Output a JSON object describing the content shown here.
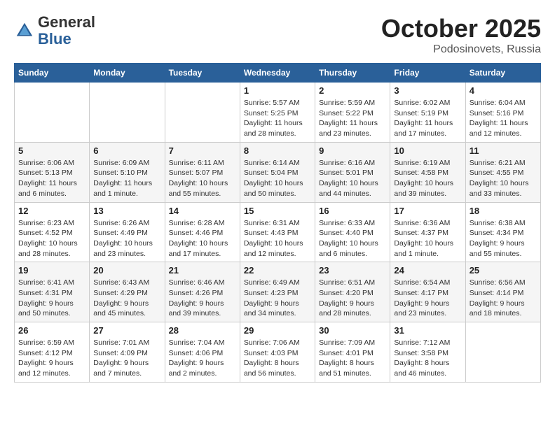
{
  "logo": {
    "general": "General",
    "blue": "Blue"
  },
  "header": {
    "month": "October 2025",
    "location": "Podosinovets, Russia"
  },
  "weekdays": [
    "Sunday",
    "Monday",
    "Tuesday",
    "Wednesday",
    "Thursday",
    "Friday",
    "Saturday"
  ],
  "weeks": [
    [
      {
        "day": "",
        "info": ""
      },
      {
        "day": "",
        "info": ""
      },
      {
        "day": "",
        "info": ""
      },
      {
        "day": "1",
        "info": "Sunrise: 5:57 AM\nSunset: 5:25 PM\nDaylight: 11 hours\nand 28 minutes."
      },
      {
        "day": "2",
        "info": "Sunrise: 5:59 AM\nSunset: 5:22 PM\nDaylight: 11 hours\nand 23 minutes."
      },
      {
        "day": "3",
        "info": "Sunrise: 6:02 AM\nSunset: 5:19 PM\nDaylight: 11 hours\nand 17 minutes."
      },
      {
        "day": "4",
        "info": "Sunrise: 6:04 AM\nSunset: 5:16 PM\nDaylight: 11 hours\nand 12 minutes."
      }
    ],
    [
      {
        "day": "5",
        "info": "Sunrise: 6:06 AM\nSunset: 5:13 PM\nDaylight: 11 hours\nand 6 minutes."
      },
      {
        "day": "6",
        "info": "Sunrise: 6:09 AM\nSunset: 5:10 PM\nDaylight: 11 hours\nand 1 minute."
      },
      {
        "day": "7",
        "info": "Sunrise: 6:11 AM\nSunset: 5:07 PM\nDaylight: 10 hours\nand 55 minutes."
      },
      {
        "day": "8",
        "info": "Sunrise: 6:14 AM\nSunset: 5:04 PM\nDaylight: 10 hours\nand 50 minutes."
      },
      {
        "day": "9",
        "info": "Sunrise: 6:16 AM\nSunset: 5:01 PM\nDaylight: 10 hours\nand 44 minutes."
      },
      {
        "day": "10",
        "info": "Sunrise: 6:19 AM\nSunset: 4:58 PM\nDaylight: 10 hours\nand 39 minutes."
      },
      {
        "day": "11",
        "info": "Sunrise: 6:21 AM\nSunset: 4:55 PM\nDaylight: 10 hours\nand 33 minutes."
      }
    ],
    [
      {
        "day": "12",
        "info": "Sunrise: 6:23 AM\nSunset: 4:52 PM\nDaylight: 10 hours\nand 28 minutes."
      },
      {
        "day": "13",
        "info": "Sunrise: 6:26 AM\nSunset: 4:49 PM\nDaylight: 10 hours\nand 23 minutes."
      },
      {
        "day": "14",
        "info": "Sunrise: 6:28 AM\nSunset: 4:46 PM\nDaylight: 10 hours\nand 17 minutes."
      },
      {
        "day": "15",
        "info": "Sunrise: 6:31 AM\nSunset: 4:43 PM\nDaylight: 10 hours\nand 12 minutes."
      },
      {
        "day": "16",
        "info": "Sunrise: 6:33 AM\nSunset: 4:40 PM\nDaylight: 10 hours\nand 6 minutes."
      },
      {
        "day": "17",
        "info": "Sunrise: 6:36 AM\nSunset: 4:37 PM\nDaylight: 10 hours\nand 1 minute."
      },
      {
        "day": "18",
        "info": "Sunrise: 6:38 AM\nSunset: 4:34 PM\nDaylight: 9 hours\nand 55 minutes."
      }
    ],
    [
      {
        "day": "19",
        "info": "Sunrise: 6:41 AM\nSunset: 4:31 PM\nDaylight: 9 hours\nand 50 minutes."
      },
      {
        "day": "20",
        "info": "Sunrise: 6:43 AM\nSunset: 4:29 PM\nDaylight: 9 hours\nand 45 minutes."
      },
      {
        "day": "21",
        "info": "Sunrise: 6:46 AM\nSunset: 4:26 PM\nDaylight: 9 hours\nand 39 minutes."
      },
      {
        "day": "22",
        "info": "Sunrise: 6:49 AM\nSunset: 4:23 PM\nDaylight: 9 hours\nand 34 minutes."
      },
      {
        "day": "23",
        "info": "Sunrise: 6:51 AM\nSunset: 4:20 PM\nDaylight: 9 hours\nand 28 minutes."
      },
      {
        "day": "24",
        "info": "Sunrise: 6:54 AM\nSunset: 4:17 PM\nDaylight: 9 hours\nand 23 minutes."
      },
      {
        "day": "25",
        "info": "Sunrise: 6:56 AM\nSunset: 4:14 PM\nDaylight: 9 hours\nand 18 minutes."
      }
    ],
    [
      {
        "day": "26",
        "info": "Sunrise: 6:59 AM\nSunset: 4:12 PM\nDaylight: 9 hours\nand 12 minutes."
      },
      {
        "day": "27",
        "info": "Sunrise: 7:01 AM\nSunset: 4:09 PM\nDaylight: 9 hours\nand 7 minutes."
      },
      {
        "day": "28",
        "info": "Sunrise: 7:04 AM\nSunset: 4:06 PM\nDaylight: 9 hours\nand 2 minutes."
      },
      {
        "day": "29",
        "info": "Sunrise: 7:06 AM\nSunset: 4:03 PM\nDaylight: 8 hours\nand 56 minutes."
      },
      {
        "day": "30",
        "info": "Sunrise: 7:09 AM\nSunset: 4:01 PM\nDaylight: 8 hours\nand 51 minutes."
      },
      {
        "day": "31",
        "info": "Sunrise: 7:12 AM\nSunset: 3:58 PM\nDaylight: 8 hours\nand 46 minutes."
      },
      {
        "day": "",
        "info": ""
      }
    ]
  ]
}
